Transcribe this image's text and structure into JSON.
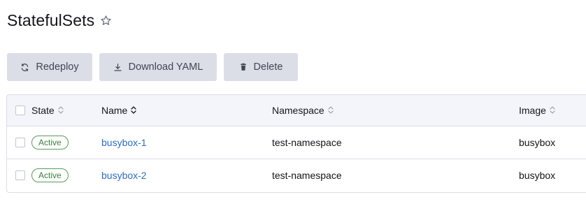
{
  "page": {
    "title": "StatefulSets",
    "star_icon": "star-outline-icon"
  },
  "toolbar": {
    "redeploy_label": "Redeploy",
    "redeploy_icon": "refresh-icon",
    "download_label": "Download YAML",
    "download_icon": "download-icon",
    "delete_label": "Delete",
    "delete_icon": "trash-icon"
  },
  "table": {
    "columns": {
      "state": "State",
      "name": "Name",
      "namespace": "Namespace",
      "image": "Image"
    },
    "rows": [
      {
        "state": "Active",
        "name": "busybox-1",
        "namespace": "test-namespace",
        "image": "busybox"
      },
      {
        "state": "Active",
        "name": "busybox-2",
        "namespace": "test-namespace",
        "image": "busybox"
      }
    ]
  },
  "colors": {
    "button_bg": "#dcdee7",
    "link": "#2d6fb5",
    "active_badge": "#3d7d3f"
  }
}
